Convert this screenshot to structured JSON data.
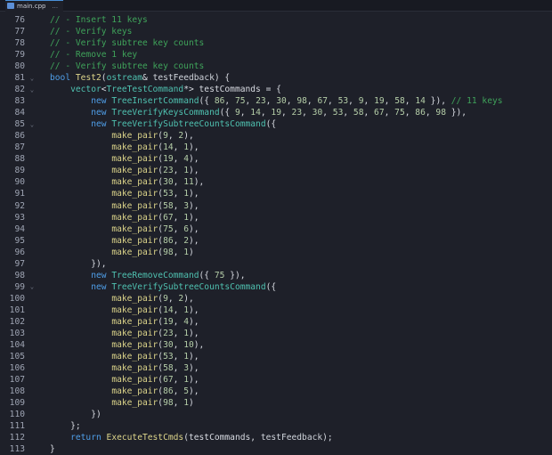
{
  "tab": {
    "file": "main.cpp",
    "more": "..."
  },
  "lines": [
    {
      "n": "76",
      "fold": "",
      "indent": 0,
      "tokens": [
        [
          "cm",
          "// - Insert 11 keys"
        ]
      ]
    },
    {
      "n": "77",
      "fold": "",
      "indent": 0,
      "tokens": [
        [
          "cm",
          "// - Verify keys"
        ]
      ]
    },
    {
      "n": "78",
      "fold": "",
      "indent": 0,
      "tokens": [
        [
          "cm",
          "// - Verify subtree key counts"
        ]
      ]
    },
    {
      "n": "79",
      "fold": "",
      "indent": 0,
      "tokens": [
        [
          "cm",
          "// - Remove 1 key"
        ]
      ]
    },
    {
      "n": "80",
      "fold": "",
      "indent": 0,
      "tokens": [
        [
          "cm",
          "// - Verify subtree key counts"
        ]
      ]
    },
    {
      "n": "81",
      "fold": "v",
      "indent": 0,
      "tokens": [
        [
          "kw",
          "bool "
        ],
        [
          "fn",
          "Test2"
        ],
        [
          "pu",
          "("
        ],
        [
          "ty",
          "ostream"
        ],
        [
          "pu",
          "& "
        ],
        [
          "pr",
          "testFeedback"
        ],
        [
          "pu",
          ") {"
        ]
      ]
    },
    {
      "n": "82",
      "fold": "v",
      "indent": 1,
      "tokens": [
        [
          "ty",
          "vector"
        ],
        [
          "pu",
          "<"
        ],
        [
          "ty",
          "TreeTestCommand"
        ],
        [
          "pu",
          "*> "
        ],
        [
          "id",
          "testCommands"
        ],
        [
          "pu",
          " = {"
        ]
      ]
    },
    {
      "n": "83",
      "fold": "",
      "indent": 2,
      "tokens": [
        [
          "kw",
          "new "
        ],
        [
          "ty",
          "TreeInsertCommand"
        ],
        [
          "pu",
          "({ "
        ],
        [
          "num",
          "86"
        ],
        [
          "pu",
          ", "
        ],
        [
          "num",
          "75"
        ],
        [
          "pu",
          ", "
        ],
        [
          "num",
          "23"
        ],
        [
          "pu",
          ", "
        ],
        [
          "num",
          "30"
        ],
        [
          "pu",
          ", "
        ],
        [
          "num",
          "98"
        ],
        [
          "pu",
          ", "
        ],
        [
          "num",
          "67"
        ],
        [
          "pu",
          ", "
        ],
        [
          "num",
          "53"
        ],
        [
          "pu",
          ", "
        ],
        [
          "num",
          "9"
        ],
        [
          "pu",
          ", "
        ],
        [
          "num",
          "19"
        ],
        [
          "pu",
          ", "
        ],
        [
          "num",
          "58"
        ],
        [
          "pu",
          ", "
        ],
        [
          "num",
          "14"
        ],
        [
          "pu",
          " }), "
        ],
        [
          "cm",
          "// 11 keys"
        ]
      ]
    },
    {
      "n": "84",
      "fold": "",
      "indent": 2,
      "tokens": [
        [
          "kw",
          "new "
        ],
        [
          "ty",
          "TreeVerifyKeysCommand"
        ],
        [
          "pu",
          "({ "
        ],
        [
          "num",
          "9"
        ],
        [
          "pu",
          ", "
        ],
        [
          "num",
          "14"
        ],
        [
          "pu",
          ", "
        ],
        [
          "num",
          "19"
        ],
        [
          "pu",
          ", "
        ],
        [
          "num",
          "23"
        ],
        [
          "pu",
          ", "
        ],
        [
          "num",
          "30"
        ],
        [
          "pu",
          ", "
        ],
        [
          "num",
          "53"
        ],
        [
          "pu",
          ", "
        ],
        [
          "num",
          "58"
        ],
        [
          "pu",
          ", "
        ],
        [
          "num",
          "67"
        ],
        [
          "pu",
          ", "
        ],
        [
          "num",
          "75"
        ],
        [
          "pu",
          ", "
        ],
        [
          "num",
          "86"
        ],
        [
          "pu",
          ", "
        ],
        [
          "num",
          "98"
        ],
        [
          "pu",
          " }),"
        ]
      ]
    },
    {
      "n": "85",
      "fold": "v",
      "indent": 2,
      "tokens": [
        [
          "kw",
          "new "
        ],
        [
          "ty",
          "TreeVerifySubtreeCountsCommand"
        ],
        [
          "pu",
          "({"
        ]
      ]
    },
    {
      "n": "86",
      "fold": "",
      "indent": 3,
      "tokens": [
        [
          "fn",
          "make_pair"
        ],
        [
          "pu",
          "("
        ],
        [
          "num",
          "9"
        ],
        [
          "pu",
          ", "
        ],
        [
          "num",
          "2"
        ],
        [
          "pu",
          "),"
        ]
      ]
    },
    {
      "n": "87",
      "fold": "",
      "indent": 3,
      "tokens": [
        [
          "fn",
          "make_pair"
        ],
        [
          "pu",
          "("
        ],
        [
          "num",
          "14"
        ],
        [
          "pu",
          ", "
        ],
        [
          "num",
          "1"
        ],
        [
          "pu",
          "),"
        ]
      ]
    },
    {
      "n": "88",
      "fold": "",
      "indent": 3,
      "tokens": [
        [
          "fn",
          "make_pair"
        ],
        [
          "pu",
          "("
        ],
        [
          "num",
          "19"
        ],
        [
          "pu",
          ", "
        ],
        [
          "num",
          "4"
        ],
        [
          "pu",
          "),"
        ]
      ]
    },
    {
      "n": "89",
      "fold": "",
      "indent": 3,
      "tokens": [
        [
          "fn",
          "make_pair"
        ],
        [
          "pu",
          "("
        ],
        [
          "num",
          "23"
        ],
        [
          "pu",
          ", "
        ],
        [
          "num",
          "1"
        ],
        [
          "pu",
          "),"
        ]
      ]
    },
    {
      "n": "90",
      "fold": "",
      "indent": 3,
      "tokens": [
        [
          "fn",
          "make_pair"
        ],
        [
          "pu",
          "("
        ],
        [
          "num",
          "30"
        ],
        [
          "pu",
          ", "
        ],
        [
          "num",
          "11"
        ],
        [
          "pu",
          "),"
        ]
      ]
    },
    {
      "n": "91",
      "fold": "",
      "indent": 3,
      "tokens": [
        [
          "fn",
          "make_pair"
        ],
        [
          "pu",
          "("
        ],
        [
          "num",
          "53"
        ],
        [
          "pu",
          ", "
        ],
        [
          "num",
          "1"
        ],
        [
          "pu",
          "),"
        ]
      ]
    },
    {
      "n": "92",
      "fold": "",
      "indent": 3,
      "tokens": [
        [
          "fn",
          "make_pair"
        ],
        [
          "pu",
          "("
        ],
        [
          "num",
          "58"
        ],
        [
          "pu",
          ", "
        ],
        [
          "num",
          "3"
        ],
        [
          "pu",
          "),"
        ]
      ]
    },
    {
      "n": "93",
      "fold": "",
      "indent": 3,
      "tokens": [
        [
          "fn",
          "make_pair"
        ],
        [
          "pu",
          "("
        ],
        [
          "num",
          "67"
        ],
        [
          "pu",
          ", "
        ],
        [
          "num",
          "1"
        ],
        [
          "pu",
          "),"
        ]
      ]
    },
    {
      "n": "94",
      "fold": "",
      "indent": 3,
      "tokens": [
        [
          "fn",
          "make_pair"
        ],
        [
          "pu",
          "("
        ],
        [
          "num",
          "75"
        ],
        [
          "pu",
          ", "
        ],
        [
          "num",
          "6"
        ],
        [
          "pu",
          "),"
        ]
      ]
    },
    {
      "n": "95",
      "fold": "",
      "indent": 3,
      "tokens": [
        [
          "fn",
          "make_pair"
        ],
        [
          "pu",
          "("
        ],
        [
          "num",
          "86"
        ],
        [
          "pu",
          ", "
        ],
        [
          "num",
          "2"
        ],
        [
          "pu",
          "),"
        ]
      ]
    },
    {
      "n": "96",
      "fold": "",
      "indent": 3,
      "tokens": [
        [
          "fn",
          "make_pair"
        ],
        [
          "pu",
          "("
        ],
        [
          "num",
          "98"
        ],
        [
          "pu",
          ", "
        ],
        [
          "num",
          "1"
        ],
        [
          "pu",
          ")"
        ]
      ]
    },
    {
      "n": "97",
      "fold": "",
      "indent": 2,
      "tokens": [
        [
          "pu",
          "}),"
        ]
      ]
    },
    {
      "n": "98",
      "fold": "",
      "indent": 2,
      "tokens": [
        [
          "kw",
          "new "
        ],
        [
          "ty",
          "TreeRemoveCommand"
        ],
        [
          "pu",
          "({ "
        ],
        [
          "num",
          "75"
        ],
        [
          "pu",
          " }),"
        ]
      ]
    },
    {
      "n": "99",
      "fold": "v",
      "indent": 2,
      "tokens": [
        [
          "kw",
          "new "
        ],
        [
          "ty",
          "TreeVerifySubtreeCountsCommand"
        ],
        [
          "pu",
          "({"
        ]
      ]
    },
    {
      "n": "100",
      "fold": "",
      "indent": 3,
      "tokens": [
        [
          "fn",
          "make_pair"
        ],
        [
          "pu",
          "("
        ],
        [
          "num",
          "9"
        ],
        [
          "pu",
          ", "
        ],
        [
          "num",
          "2"
        ],
        [
          "pu",
          "),"
        ]
      ]
    },
    {
      "n": "101",
      "fold": "",
      "indent": 3,
      "tokens": [
        [
          "fn",
          "make_pair"
        ],
        [
          "pu",
          "("
        ],
        [
          "num",
          "14"
        ],
        [
          "pu",
          ", "
        ],
        [
          "num",
          "1"
        ],
        [
          "pu",
          "),"
        ]
      ]
    },
    {
      "n": "102",
      "fold": "",
      "indent": 3,
      "tokens": [
        [
          "fn",
          "make_pair"
        ],
        [
          "pu",
          "("
        ],
        [
          "num",
          "19"
        ],
        [
          "pu",
          ", "
        ],
        [
          "num",
          "4"
        ],
        [
          "pu",
          "),"
        ]
      ]
    },
    {
      "n": "103",
      "fold": "",
      "indent": 3,
      "tokens": [
        [
          "fn",
          "make_pair"
        ],
        [
          "pu",
          "("
        ],
        [
          "num",
          "23"
        ],
        [
          "pu",
          ", "
        ],
        [
          "num",
          "1"
        ],
        [
          "pu",
          "),"
        ]
      ]
    },
    {
      "n": "104",
      "fold": "",
      "indent": 3,
      "tokens": [
        [
          "fn",
          "make_pair"
        ],
        [
          "pu",
          "("
        ],
        [
          "num",
          "30"
        ],
        [
          "pu",
          ", "
        ],
        [
          "num",
          "10"
        ],
        [
          "pu",
          "),"
        ]
      ]
    },
    {
      "n": "105",
      "fold": "",
      "indent": 3,
      "tokens": [
        [
          "fn",
          "make_pair"
        ],
        [
          "pu",
          "("
        ],
        [
          "num",
          "53"
        ],
        [
          "pu",
          ", "
        ],
        [
          "num",
          "1"
        ],
        [
          "pu",
          "),"
        ]
      ]
    },
    {
      "n": "106",
      "fold": "",
      "indent": 3,
      "tokens": [
        [
          "fn",
          "make_pair"
        ],
        [
          "pu",
          "("
        ],
        [
          "num",
          "58"
        ],
        [
          "pu",
          ", "
        ],
        [
          "num",
          "3"
        ],
        [
          "pu",
          "),"
        ]
      ]
    },
    {
      "n": "107",
      "fold": "",
      "indent": 3,
      "tokens": [
        [
          "fn",
          "make_pair"
        ],
        [
          "pu",
          "("
        ],
        [
          "num",
          "67"
        ],
        [
          "pu",
          ", "
        ],
        [
          "num",
          "1"
        ],
        [
          "pu",
          "),"
        ]
      ]
    },
    {
      "n": "108",
      "fold": "",
      "indent": 3,
      "tokens": [
        [
          "fn",
          "make_pair"
        ],
        [
          "pu",
          "("
        ],
        [
          "num",
          "86"
        ],
        [
          "pu",
          ", "
        ],
        [
          "num",
          "5"
        ],
        [
          "pu",
          "),"
        ]
      ]
    },
    {
      "n": "109",
      "fold": "",
      "indent": 3,
      "tokens": [
        [
          "fn",
          "make_pair"
        ],
        [
          "pu",
          "("
        ],
        [
          "num",
          "98"
        ],
        [
          "pu",
          ", "
        ],
        [
          "num",
          "1"
        ],
        [
          "pu",
          ")"
        ]
      ]
    },
    {
      "n": "110",
      "fold": "",
      "indent": 2,
      "tokens": [
        [
          "pu",
          "})"
        ]
      ]
    },
    {
      "n": "111",
      "fold": "",
      "indent": 1,
      "tokens": [
        [
          "pu",
          "};"
        ]
      ]
    },
    {
      "n": "112",
      "fold": "",
      "indent": 1,
      "tokens": [
        [
          "kw",
          "return "
        ],
        [
          "fn",
          "ExecuteTestCmds"
        ],
        [
          "pu",
          "("
        ],
        [
          "id",
          "testCommands"
        ],
        [
          "pu",
          ", "
        ],
        [
          "pr",
          "testFeedback"
        ],
        [
          "pu",
          ");"
        ]
      ]
    },
    {
      "n": "113",
      "fold": "",
      "indent": 0,
      "tokens": [
        [
          "pu",
          "}"
        ]
      ]
    }
  ]
}
